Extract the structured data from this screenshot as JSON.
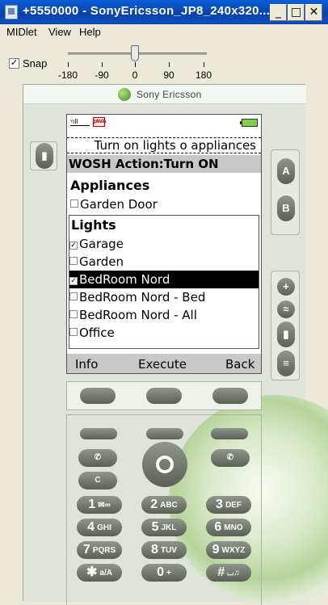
{
  "window": {
    "title": "+5550000 - SonyEricsson_JP8_240x320...",
    "minimize": "_",
    "maximize": "□",
    "close": "✕"
  },
  "menubar": {
    "items": [
      "MIDlet",
      "View",
      "Help"
    ]
  },
  "snap": {
    "label": "Snap",
    "checked": "✓",
    "ticks": [
      "-180",
      "-90",
      "0",
      "90",
      "180"
    ],
    "rotation_value": 0
  },
  "phone": {
    "brand": "Sony Ericsson",
    "side_keys": {
      "a": "A",
      "b": "B"
    }
  },
  "screen": {
    "ticker": "Turn on lights o appliances",
    "form_title": "WOSH Action:Turn ON",
    "java_badge": "JAVA",
    "appliances": {
      "label": "Appliances",
      "items": [
        {
          "label": "Garden Door",
          "checked": false
        }
      ]
    },
    "lights": {
      "label": "Lights",
      "items": [
        {
          "label": "Garage",
          "checked": true,
          "selected": false
        },
        {
          "label": "Garden",
          "checked": false,
          "selected": false
        },
        {
          "label": "BedRoom Nord",
          "checked": true,
          "selected": true
        },
        {
          "label": "BedRoom Nord - Bed",
          "checked": false,
          "selected": false
        },
        {
          "label": "BedRoom Nord - All",
          "checked": false,
          "selected": false
        },
        {
          "label": "Office",
          "checked": false,
          "selected": false
        }
      ]
    },
    "softkeys": {
      "left": "Info",
      "center": "Execute",
      "right": "Back"
    }
  },
  "keypad": {
    "keys": [
      {
        "num": "1",
        "letters": "✉∞"
      },
      {
        "num": "2",
        "letters": "ABC"
      },
      {
        "num": "3",
        "letters": "DEF"
      },
      {
        "num": "4",
        "letters": "GHI"
      },
      {
        "num": "5",
        "letters": "JKL"
      },
      {
        "num": "6",
        "letters": "MNO"
      },
      {
        "num": "7",
        "letters": "PQRS"
      },
      {
        "num": "8",
        "letters": "TUV"
      },
      {
        "num": "9",
        "letters": "WXYZ"
      },
      {
        "num": "✱",
        "letters": "a/A"
      },
      {
        "num": "0",
        "letters": "+"
      },
      {
        "num": "#",
        "letters": "⌴♫"
      }
    ],
    "clear": "C"
  },
  "colors": {
    "titlebar": "#0a4fc2",
    "highlight": "#000000",
    "battery": "#7ed04b"
  }
}
